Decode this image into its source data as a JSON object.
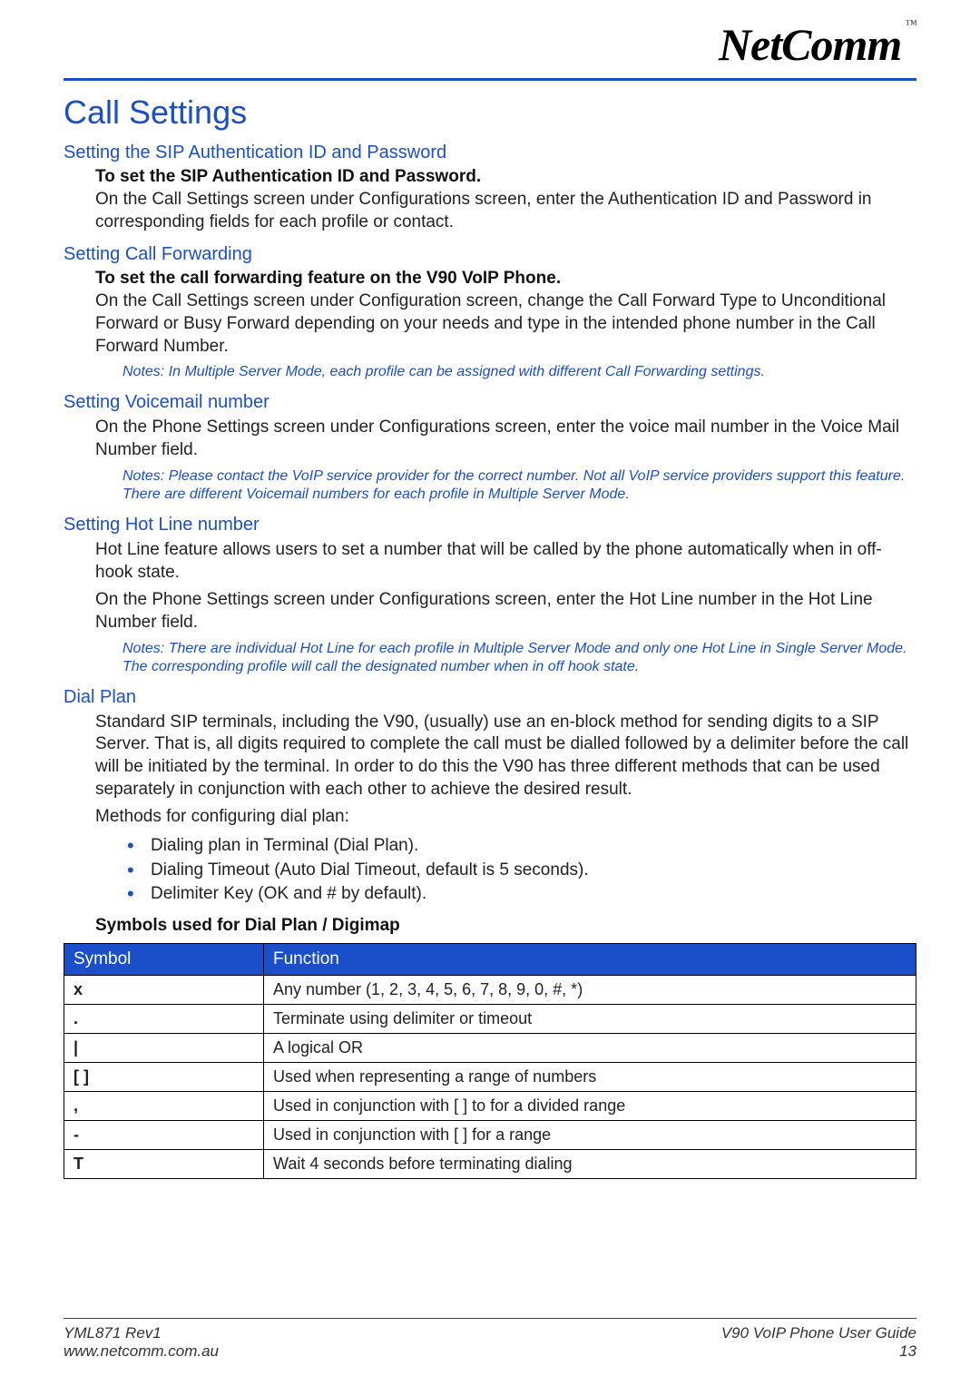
{
  "brand": {
    "name": "NetComm",
    "tm": "™"
  },
  "title": "Call Settings",
  "sections": {
    "sip": {
      "heading": "Setting the SIP Authentication ID and Password",
      "lead": "To set the SIP Authentication ID and Password.",
      "body": "On the Call Settings screen under Configurations screen, enter the Authentication ID and Password in corresponding fields for each profile or contact."
    },
    "fwd": {
      "heading": "Setting Call Forwarding",
      "lead": "To set the call forwarding feature on the V90 VoIP Phone.",
      "body": "On the Call Settings screen under Configuration screen, change the Call Forward Type to Unconditional Forward or Busy Forward depending on your needs and type in the intended phone number in the Call Forward Number.",
      "note": "Notes: In Multiple Server Mode, each profile can be assigned with different Call Forwarding settings."
    },
    "vm": {
      "heading": "Setting Voicemail number",
      "body": "On the Phone Settings screen under Configurations screen, enter the voice mail number in the Voice Mail Number field.",
      "note": "Notes: Please contact the VoIP service provider for the correct number. Not all VoIP service providers support this feature. There are different Voicemail numbers for each profile in Multiple Server Mode."
    },
    "hot": {
      "heading": "Setting Hot Line number",
      "body1": "Hot Line feature allows users to set a number that will be called by the phone automatically when in off-hook state.",
      "body2": "On the Phone Settings screen under Configurations screen, enter the Hot Line number in the Hot Line Number field.",
      "note": "Notes: There are individual Hot Line for each profile in Multiple Server Mode and only one Hot Line in Single Server Mode. The corresponding profile will call the designated number when in off hook state."
    },
    "dial": {
      "heading": "Dial Plan",
      "body1": "Standard SIP terminals, including the V90, (usually) use an en-block method for sending digits to a SIP Server. That is, all digits required to complete the call must be dialled followed by a delimiter before the call will be initiated by the terminal.  In order to do this the V90 has three different methods that can be used separately in conjunction with each other to achieve the desired result.",
      "body2": "Methods for configuring dial plan:",
      "bullets": [
        "Dialing plan in Terminal (Dial Plan).",
        "Dialing Timeout (Auto Dial Timeout, default is 5 seconds).",
        "Delimiter Key (OK and # by default)."
      ],
      "tableTitle": "Symbols used for Dial Plan / Digimap",
      "tableHeaders": {
        "c1": "Symbol",
        "c2": "Function"
      },
      "rows": [
        {
          "sym": "x",
          "fn": "Any number (1, 2, 3, 4, 5, 6, 7, 8, 9, 0, #, *)"
        },
        {
          "sym": ".",
          "fn": "Terminate using delimiter or timeout"
        },
        {
          "sym": "|",
          "fn": "A logical OR"
        },
        {
          "sym": "[ ]",
          "fn": "Used when representing a range of numbers"
        },
        {
          "sym": ",",
          "fn": "Used in conjunction with [ ] to for a divided range"
        },
        {
          "sym": "-",
          "fn": "Used in conjunction with [ ] for a range"
        },
        {
          "sym": "T",
          "fn": "Wait 4 seconds before terminating dialing"
        }
      ]
    }
  },
  "footer": {
    "leftTop": "YML871 Rev1",
    "leftBottom": "www.netcomm.com.au",
    "rightTop": "V90 VoIP Phone User Guide",
    "rightBottom": "13"
  }
}
